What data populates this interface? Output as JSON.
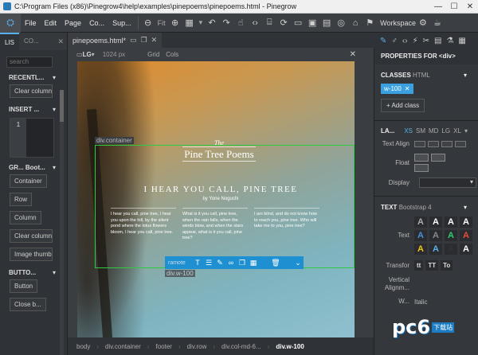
{
  "titlebar": {
    "title": "C:\\Program Files (x86)\\Pinegrow4\\help\\examples\\pinepoems\\pinepoems.html - Pinegrow",
    "minimize": "—",
    "maximize": "☐",
    "close": "✕"
  },
  "menubar": {
    "items": [
      "File",
      "Edit",
      "Page",
      "Co...",
      "Sup..."
    ],
    "fit_label": "Fit",
    "workspace_label": "Workspace"
  },
  "leftpanel": {
    "tabs": [
      "LIS",
      "CO..."
    ],
    "close": "✕",
    "search_placeholder": "search",
    "recent": {
      "title": "RECENTL...",
      "chevron": "▾",
      "items": [
        "Clear column"
      ]
    },
    "insert": {
      "title": "INSERT ...",
      "chevron": "▾",
      "grid_first": "1"
    },
    "grid": {
      "title": "GR... Boot...",
      "chevron": "▾",
      "items": [
        "Container",
        "Row",
        "Column",
        "Clear column",
        "Image thumb"
      ]
    },
    "buttons": {
      "title": "BUTTO...",
      "chevron": "▾",
      "items": [
        "Button",
        "Close b..."
      ]
    }
  },
  "doc": {
    "tab_label": "pinepoems.html*",
    "view": {
      "device": "LG",
      "chevron": "▾",
      "width": "1024 px",
      "grid": "Grid",
      "cols": "Cols",
      "close": "✕"
    }
  },
  "page": {
    "logo_the": "The",
    "logo_name": "Pine Tree Poems",
    "headline": "I HEAR YOU CALL, PINE TREE",
    "byline": "by Yone Noguchi",
    "columns": [
      "I hear you call, pine tree, I hear you upon the hill, by the silent pond where the lotus flowers bloom, I hear you call, pine tree.",
      "What is it you call, pine tree, when the rain falls, when the winds blow, and when the stars appear, what is it you call, pine tree?",
      "I am blind, and do not know how to reach you, pine tree. Who will take me to you, pine tree?"
    ],
    "container_label": "div.container",
    "action_name": "ramote",
    "selected_label": "div.w-100"
  },
  "breadcrumb": [
    "body",
    "div.container",
    "footer",
    "div.row",
    "div.col-md-6...",
    "div.w-100"
  ],
  "rightpanel": {
    "title": "PROPERTIES FOR <div>",
    "classes": {
      "label": "CLASSES",
      "sub": "HTML",
      "tag": "w-100",
      "remove": "✕",
      "add": "+ Add class"
    },
    "layout": {
      "label": "LA...",
      "breakpoints": [
        "XS",
        "SM",
        "MD",
        "LG",
        "XL"
      ],
      "text_align": "Text Align",
      "float": "Float",
      "display": "Display"
    },
    "text": {
      "label": "TEXT",
      "sub": "Bootstrap 4",
      "text_label": "Text",
      "transform": "Transfor",
      "tt": [
        "tt",
        "TT",
        "To"
      ],
      "vertical": "Vertical Alignm...",
      "weight": "W...",
      "italic": "Italic"
    },
    "text_swatch_letter": "A",
    "text_swatches": [
      "#aaaaaa",
      "#ffffff",
      "#ffffff",
      "#ffffff",
      "#4a90d9",
      "#888888",
      "#2ecc71",
      "#e74c3c",
      "#f1c40f",
      "#5ab0e8",
      "#333333",
      "#ffffff"
    ],
    "chevron": "▾"
  },
  "watermark": {
    "text": "pc6",
    "sub": "下载站"
  },
  "colors": {
    "accent": "#5ab0e8",
    "selection": "#2ecc40",
    "action": "#1e8fd0"
  }
}
